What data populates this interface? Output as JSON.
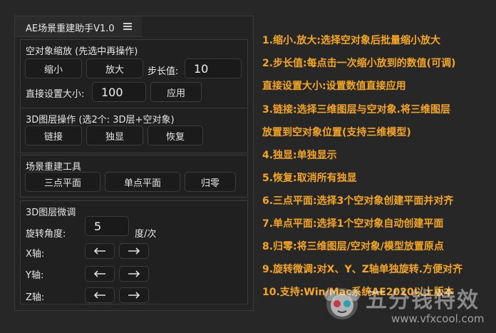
{
  "panel": {
    "title": "AE场景重建助手V1.0",
    "scale": {
      "heading": "空对象缩放 (先选中再操作)",
      "shrink_label": "缩小",
      "enlarge_label": "放大",
      "step_label": "步长值:",
      "step_value": "10",
      "direct_label": "直接设置大小:",
      "direct_value": "100",
      "apply_label": "应用"
    },
    "layer3d": {
      "heading": "3D图层操作 (选2个: 3D层+空对象)",
      "link_label": "链接",
      "solo_label": "独显",
      "restore_label": "恢复"
    },
    "rebuild": {
      "heading": "场景重建工具",
      "three_point_label": "三点平面",
      "single_point_label": "单点平面",
      "zero_label": "归零"
    },
    "fine": {
      "heading": "3D图层微调",
      "angle_label": "旋转角度:",
      "angle_value": "5",
      "angle_unit": "度/次",
      "x_label": "X轴:",
      "y_label": "Y轴:",
      "z_label": "Z轴:"
    }
  },
  "notes": [
    "1.缩小.放大:选择空对象后批量缩小放大",
    "2.步长值:每点击一次缩小放到的数值(可调)",
    "直接设置大小:设置数值直接应用",
    "3.链接:选择三维图层与空对象.将三维图层",
    "放置到空对象位置(支持三维模型)",
    "4.独显:单独显示",
    "5.恢复:取消所有独显",
    "6.三点平面:选择3个空对象创建平面并对齐",
    "7.单点平面:选择1个空对象自动创建平面",
    "8.归零:将三维图层/空对象/模型放置原点",
    "9.旋转微调:对X、Y、Z轴单独旋转.方便对齐",
    "10.支持:Win/Mac系统AE2020以上版本"
  ],
  "watermark": {
    "brand": "五分钱特效",
    "url": "www.vfxcool.com"
  },
  "colors": {
    "accent": "#f5a623",
    "panel_bg": "#232323",
    "page_bg": "#272727"
  }
}
